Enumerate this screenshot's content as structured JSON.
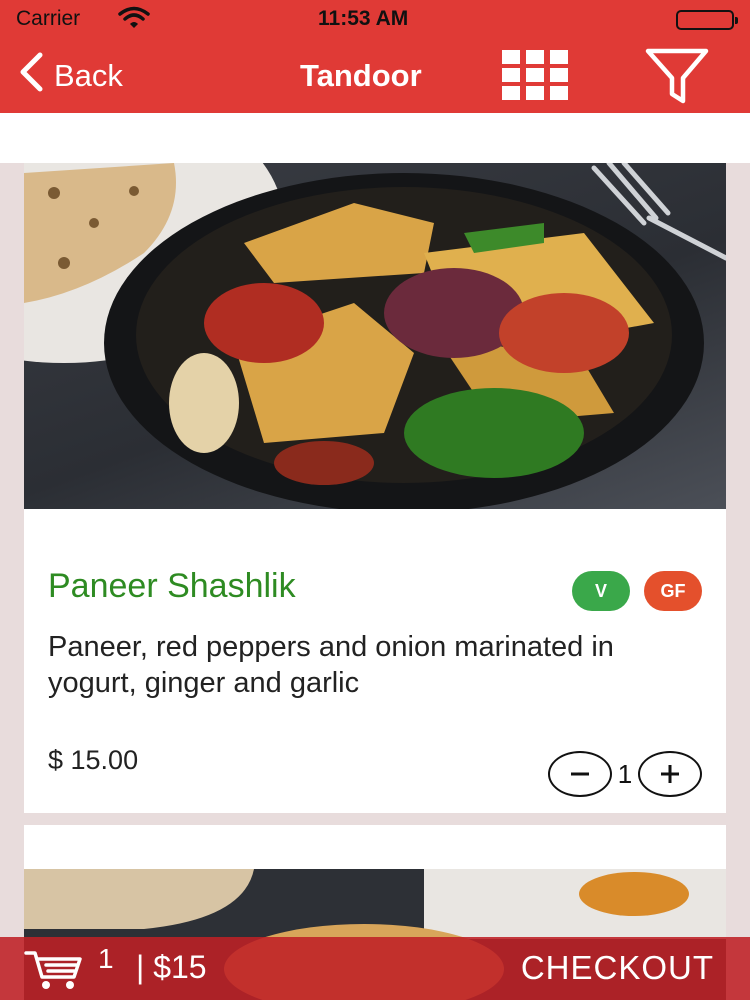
{
  "status_bar": {
    "carrier": "Carrier",
    "time": "11:53 AM",
    "icons": [
      "wifi-icon",
      "battery-icon"
    ]
  },
  "nav": {
    "back_label": "Back",
    "title": "Tandoor",
    "grid_icon": "grid-view-icon",
    "filter_icon": "filter-icon"
  },
  "colors": {
    "header": "#e03a36",
    "item_name": "#2e8b22",
    "badge_v": "#3aa84a",
    "badge_gf": "#e4502c",
    "checkout_bar": "#be2026"
  },
  "menu_items": [
    {
      "name": "Paneer Shashlik",
      "badges": [
        "V",
        "GF"
      ],
      "description": "Paneer, red peppers and onion marinated in yogurt, ginger and garlic",
      "price": "$ 15.00",
      "quantity": "1"
    }
  ],
  "checkout": {
    "cart_icon": "shopping-cart-icon",
    "count": "1",
    "total": "| $15",
    "button_label": "CHECKOUT"
  }
}
